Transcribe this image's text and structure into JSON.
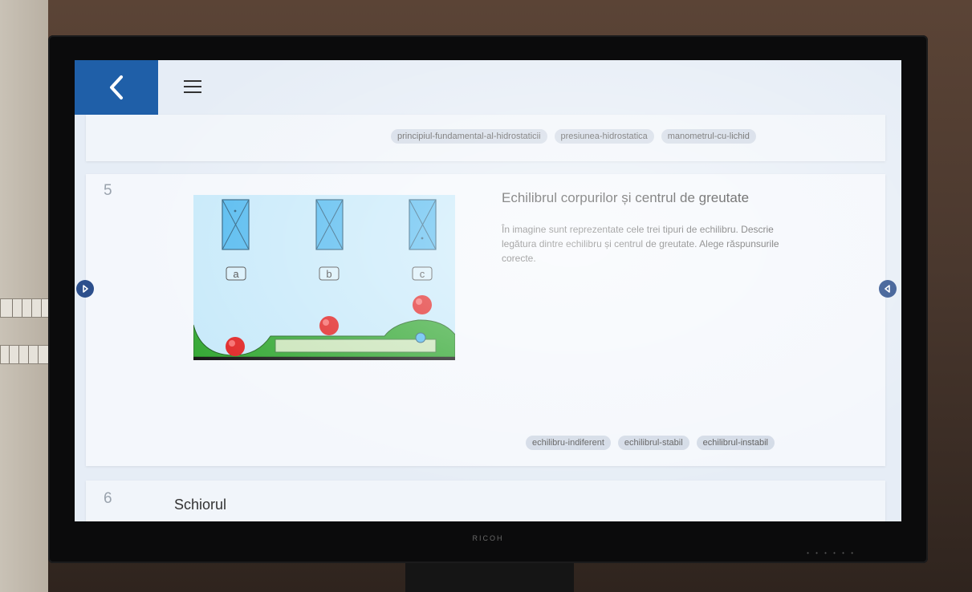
{
  "header": {
    "back_icon": "chevron-left-icon",
    "menu_icon": "hamburger-menu-icon"
  },
  "prev_card": {
    "tags": [
      "principiul-fundamental-al-hidrostaticii",
      "presiunea-hidrostatica",
      "manometrul-cu-lichid"
    ]
  },
  "current_card": {
    "number": "5",
    "title": "Echilibrul corpurilor și centrul de greutate",
    "description": "În imagine sunt reprezentate cele trei tipuri de echilibru. Descrie legătura dintre echilibru și centrul de greutate. Alege răspunsurile corecte.",
    "illustration": {
      "labels": [
        "a",
        "b",
        "c"
      ]
    },
    "tags": [
      "echilibru-indiferent",
      "echilibrul-stabil",
      "echilibrul-instabil"
    ]
  },
  "next_card": {
    "number": "6",
    "title": "Schiorul"
  },
  "navigation": {
    "left_arrow_icon": "arrow-right-icon",
    "right_arrow_icon": "arrow-left-icon"
  },
  "monitor": {
    "brand": "RICOH"
  },
  "colors": {
    "accent": "#1f5fa8",
    "tag_bg": "#d2dae6",
    "ground": "#2fa62f",
    "ball": "#e02020",
    "box": "#4fb8ef"
  }
}
